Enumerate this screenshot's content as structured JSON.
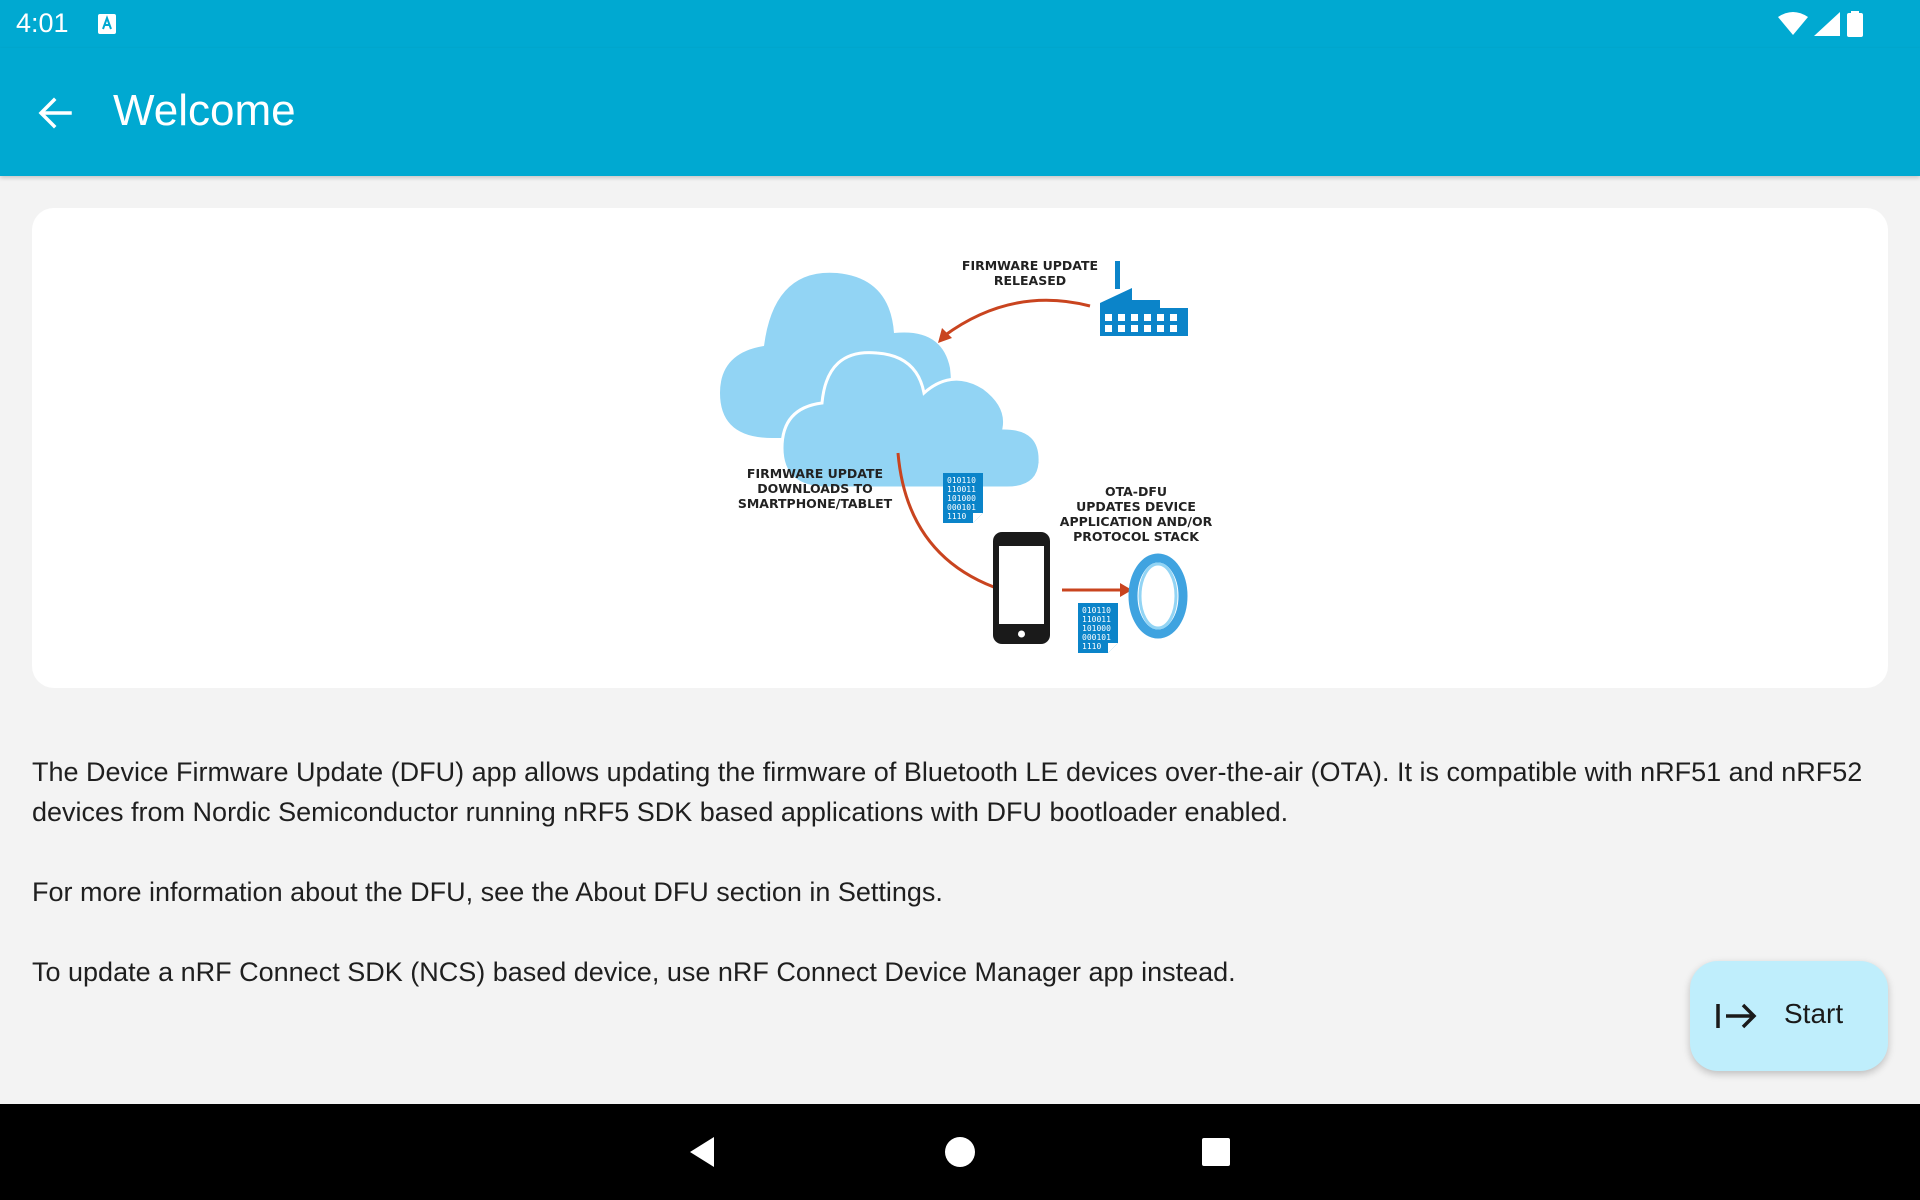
{
  "status_bar": {
    "time": "4:01",
    "icons": [
      "text-input-indicator-icon",
      "wifi-icon",
      "cell-signal-icon",
      "battery-icon"
    ]
  },
  "app_bar": {
    "title": "Welcome",
    "back_icon": "arrow-left-icon"
  },
  "illustration": {
    "label_release": [
      "FIRMWARE UPDATE",
      "RELEASED"
    ],
    "label_download": [
      "FIRMWARE UPDATE",
      "DOWNLOADS TO",
      "SMARTPHONE/TABLET"
    ],
    "label_ota": [
      "OTA-DFU",
      "UPDATES DEVICE",
      "APPLICATION AND/OR",
      "PROTOCOL STACK"
    ],
    "binary_lines": [
      "010110",
      "110011",
      "101000",
      "000101",
      "1110"
    ]
  },
  "content": {
    "paragraph_1": "The Device Firmware Update (DFU) app allows updating the firmware of Bluetooth LE devices over-the-air (OTA). It is compatible with nRF51 and nRF52 devices from Nordic Semiconductor running nRF5 SDK based applications with DFU bootloader enabled.",
    "paragraph_2": "For more information about the DFU, see the About DFU section in Settings.",
    "paragraph_3": "To update a nRF Connect SDK (NCS) based device, use nRF Connect Device Manager app instead."
  },
  "fab": {
    "label": "Start",
    "icon": "arrow-right-to-bar-icon"
  },
  "navigation_bar": {
    "icons": [
      "nav-back-icon",
      "nav-home-icon",
      "nav-recents-icon"
    ]
  },
  "colors": {
    "app_bar": "#00a9d1",
    "fab_background": "#bfeefc",
    "arrow": "#c9441f",
    "icon_blue": "#0b84c9",
    "cloud": "#92d4f4"
  }
}
